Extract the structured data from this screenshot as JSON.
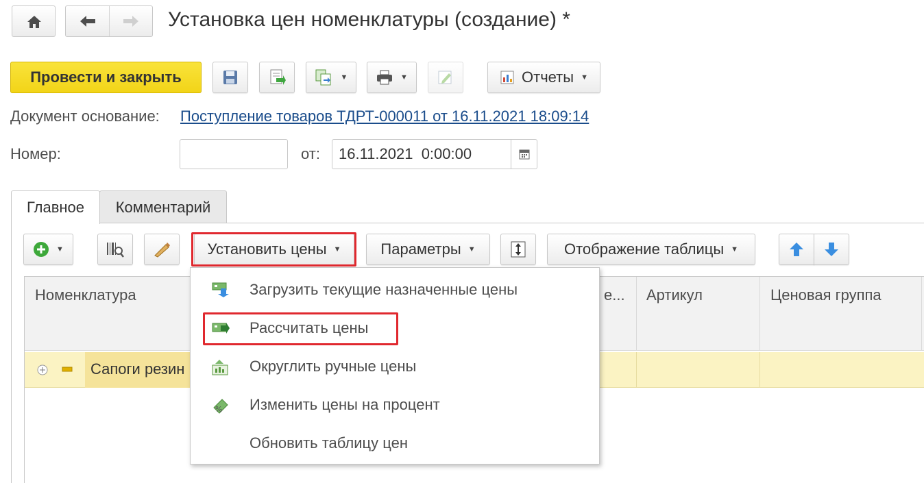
{
  "window": {
    "title": "Установка цен номенклатуры (создание) *"
  },
  "toolbar": {
    "post_close_label": "Провести и закрыть",
    "reports_label": "Отчеты"
  },
  "form": {
    "base_doc_label": "Документ основание:",
    "base_doc_link": "Поступление товаров ТДРТ-000011 от 16.11.2021 18:09:14",
    "number_label": "Номер:",
    "number_value": "",
    "date_label": "от:",
    "date_value": "16.11.2021  0:00:00"
  },
  "tabs": [
    {
      "label": "Главное",
      "active": true
    },
    {
      "label": "Комментарий",
      "active": false
    }
  ],
  "table_toolbar": {
    "set_prices_label": "Установить цены",
    "params_label": "Параметры",
    "display_label": "Отображение таблицы"
  },
  "grid": {
    "columns": [
      "Номенклатура",
      "е...",
      "Артикул",
      "Ценовая группа"
    ],
    "rows": [
      {
        "name": "Сапоги резин"
      }
    ]
  },
  "menu": {
    "items": [
      {
        "label": "Загрузить текущие назначенные цены",
        "icon": "load-prices-icon"
      },
      {
        "label": "Рассчитать цены",
        "icon": "calculate-prices-icon",
        "highlighted": true
      },
      {
        "label": "Округлить ручные цены",
        "icon": "round-prices-icon"
      },
      {
        "label": "Изменить цены на процент",
        "icon": "percent-change-icon"
      },
      {
        "label": "Обновить таблицу цен",
        "icon": ""
      }
    ]
  },
  "colors": {
    "accent_yellow": "#f5d827",
    "link_blue": "#1a4c8b",
    "highlight_red": "#e0282e",
    "row_yellow": "#fbf3c3"
  }
}
